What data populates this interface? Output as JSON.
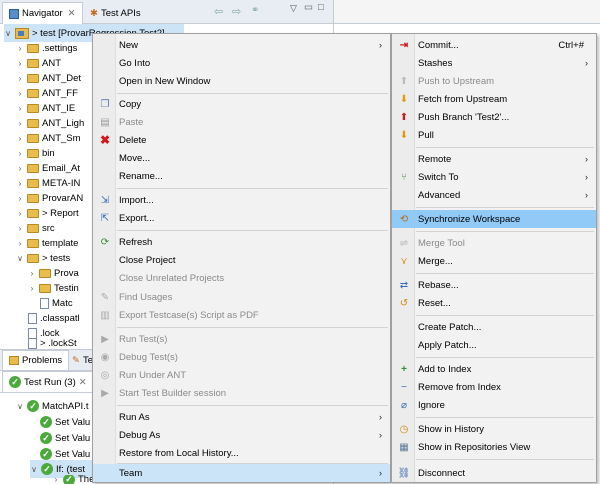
{
  "navigator": {
    "tab_label": "Navigator",
    "tab2_label": "Test APIs",
    "root_label": "> test  [ProvarRegression Test2]",
    "items": [
      ".settings",
      "ANT",
      "ANT_Det",
      "ANT_FF",
      "ANT_IE",
      "ANT_Ligh",
      "ANT_Sm",
      "bin",
      "Email_At",
      "META-IN",
      "ProvarAN",
      "> Report",
      "src",
      "template",
      "> tests",
      "Prova",
      "Testin",
      "Matc",
      ".classpatl",
      ".lock",
      "> .lockSt"
    ]
  },
  "bottom": {
    "tab_problems": "Problems",
    "tab_te": "Te",
    "test_run_label": "Test Run (3)",
    "items": [
      "MatchAPI.t",
      "Set Valu",
      "Set Valu",
      "Set Valu",
      "If: (test",
      "The"
    ]
  },
  "context_menu": {
    "items": [
      {
        "label": "New",
        "icon": "none",
        "submenu": true
      },
      {
        "label": "Go Into"
      },
      {
        "label": "Open in New Window"
      },
      {
        "label": "Copy",
        "icon": "copy-icon"
      },
      {
        "label": "Paste",
        "icon": "paste-icon",
        "disabled": true
      },
      {
        "label": "Delete",
        "icon": "delete-icon"
      },
      {
        "label": "Move..."
      },
      {
        "label": "Rename..."
      },
      {
        "label": "Import...",
        "icon": "import-icon"
      },
      {
        "label": "Export...",
        "icon": "export-icon"
      },
      {
        "label": "Refresh",
        "icon": "refresh-icon"
      },
      {
        "label": "Close Project"
      },
      {
        "label": "Close Unrelated Projects",
        "disabled": true
      },
      {
        "label": "Find Usages",
        "icon": "find-usages-icon",
        "disabled": true
      },
      {
        "label": "Export Testcase(s) Script as PDF",
        "icon": "pdf-icon",
        "disabled": true
      },
      {
        "label": "Run Test(s)",
        "icon": "run-icon",
        "disabled": true
      },
      {
        "label": "Debug Test(s)",
        "icon": "debug-icon",
        "disabled": true
      },
      {
        "label": "Run Under ANT",
        "icon": "ant-icon",
        "disabled": true
      },
      {
        "label": "Start Test Builder session",
        "icon": "builder-icon",
        "disabled": true
      },
      {
        "label": "Run As",
        "submenu": true
      },
      {
        "label": "Debug As",
        "submenu": true
      },
      {
        "label": "Restore from Local History..."
      },
      {
        "label": "Team",
        "submenu": true
      }
    ]
  },
  "team_menu": {
    "items": [
      {
        "label": "Commit...",
        "shortcut": "Ctrl+#",
        "icon": "commit-icon"
      },
      {
        "label": "Stashes",
        "submenu": true
      },
      {
        "label": "Push to Upstream",
        "icon": "push-upstream-icon",
        "disabled": true
      },
      {
        "label": "Fetch from Upstream",
        "icon": "fetch-icon"
      },
      {
        "label": "Push Branch 'Test2'...",
        "icon": "push-branch-icon"
      },
      {
        "label": "Pull",
        "icon": "pull-icon"
      },
      {
        "label": "Remote",
        "submenu": true
      },
      {
        "label": "Switch To",
        "icon": "switch-icon",
        "submenu": true
      },
      {
        "label": "Advanced",
        "submenu": true
      },
      {
        "label": "Synchronize Workspace",
        "icon": "sync-icon"
      },
      {
        "label": "Merge Tool",
        "icon": "merge-tool-icon",
        "disabled": true
      },
      {
        "label": "Merge...",
        "icon": "merge-icon"
      },
      {
        "label": "Rebase...",
        "icon": "rebase-icon"
      },
      {
        "label": "Reset...",
        "icon": "reset-icon"
      },
      {
        "label": "Create Patch..."
      },
      {
        "label": "Apply Patch..."
      },
      {
        "label": "Add to Index",
        "icon": "add-index-icon"
      },
      {
        "label": "Remove from Index",
        "icon": "remove-index-icon"
      },
      {
        "label": "Ignore",
        "icon": "ignore-icon"
      },
      {
        "label": "Show in History",
        "icon": "history-icon"
      },
      {
        "label": "Show in Repositories View",
        "icon": "repo-icon"
      },
      {
        "label": "Disconnect",
        "icon": "disconnect-icon"
      }
    ]
  }
}
